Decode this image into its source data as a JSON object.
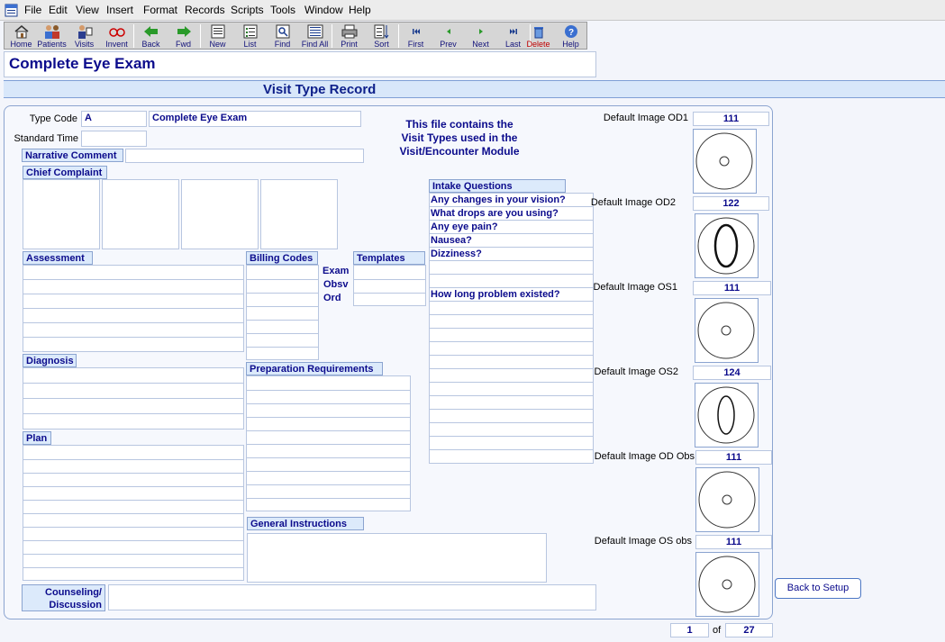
{
  "menu": [
    "File",
    "Edit",
    "View",
    "Insert",
    "Format",
    "Records",
    "Scripts",
    "Tools",
    "Window",
    "Help"
  ],
  "toolbar": {
    "home": "Home",
    "patients": "Patients",
    "visits": "Visits",
    "invent": "Invent",
    "back": "Back",
    "fwd": "Fwd",
    "new": "New",
    "list": "List",
    "find": "Find",
    "find_all": "Find  All",
    "print": "Print",
    "sort": "Sort",
    "first": "First",
    "prev": "Prev",
    "next": "Next",
    "last": "Last",
    "delete": "Delete",
    "help": "Help"
  },
  "record_title": "Complete Eye Exam",
  "header_title": "Visit Type Record",
  "fields": {
    "type_code_label": "Type Code",
    "type_code": "A",
    "type_name": "Complete Eye Exam",
    "standard_time_label": "Standard Time",
    "standard_time": "",
    "narrative_comment_label": "Narrative Comment",
    "narrative_comment": ""
  },
  "info_text": [
    "This file contains the",
    "Visit Types used in the",
    "Visit/Encounter Module"
  ],
  "sections": {
    "chief_complaint": "Chief Complaint",
    "assessment": "Assessment",
    "billing_codes": "Billing Codes",
    "templates": "Templates",
    "diagnosis": "Diagnosis",
    "preparation": "Preparation Requirements",
    "plan": "Plan",
    "general_instructions": "General Instructions",
    "intake_questions": "Intake Questions",
    "counseling_line1": "Counseling/",
    "counseling_line2": "Discussion"
  },
  "billing_labels": [
    "Exam",
    "Obsv",
    "Ord"
  ],
  "intake_questions": [
    "Any changes in your vision?",
    "What drops are you using?",
    "Any eye pain?",
    "Nausea?",
    "Dizziness?",
    "",
    "",
    "How long problem existed?",
    "",
    "",
    "",
    "",
    "",
    "",
    "",
    "",
    "",
    "",
    "",
    ""
  ],
  "default_images": [
    {
      "label": "Default Image OD1",
      "value": "111"
    },
    {
      "label": "Default Image OD2",
      "value": "122"
    },
    {
      "label": "Default Image OS1",
      "value": "111"
    },
    {
      "label": "Default Image OS2",
      "value": "124"
    },
    {
      "label": "Default Image OD Obs",
      "value": "111"
    },
    {
      "label": "Default Image OS obs",
      "value": "111"
    }
  ],
  "back_to_setup": "Back to Setup",
  "pager": {
    "current": "1",
    "of_label": "of",
    "total": "27"
  },
  "colors": {
    "accent_text": "#0b0b8c",
    "header_band": "#d8e7fa",
    "border": "#8ba4d0"
  }
}
